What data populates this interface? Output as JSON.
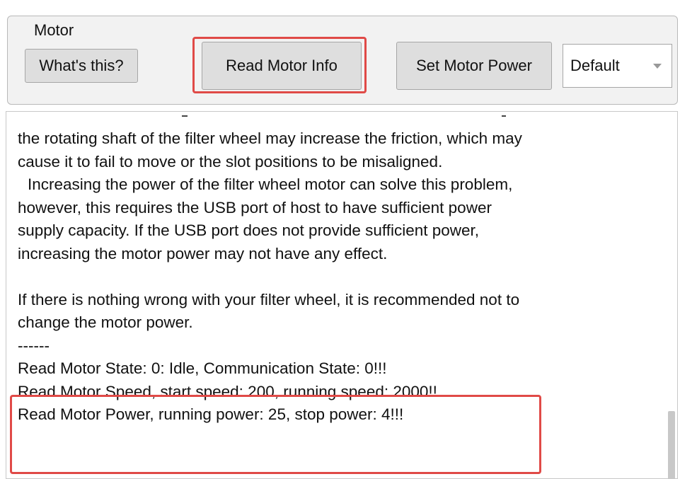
{
  "motor_group": {
    "title": "Motor",
    "whats_this_label": "What's this?",
    "read_motor_info_label": "Read Motor Info",
    "set_motor_power_label": "Set Motor Power",
    "power_select_value": "Default"
  },
  "output": {
    "lines": [
      "the rotating shaft of the filter wheel may increase the friction, which may",
      "cause it to fail to move or the slot positions to be misaligned.",
      "Increasing the power of the filter wheel motor can solve this problem,",
      "however, this requires the USB port of host to have sufficient power",
      "supply capacity. If the USB port does not provide sufficient power,",
      "increasing the motor power may not have any effect.",
      "",
      "If there is nothing wrong with your filter wheel, it is recommended not to",
      "change the motor power.",
      "------",
      "Read Motor State: 0: Idle, Communication State: 0!!!",
      "Read Motor Speed, start speed: 200, running speed: 2000!!",
      "Read Motor Power, running power: 25, stop power: 4!!!"
    ]
  }
}
